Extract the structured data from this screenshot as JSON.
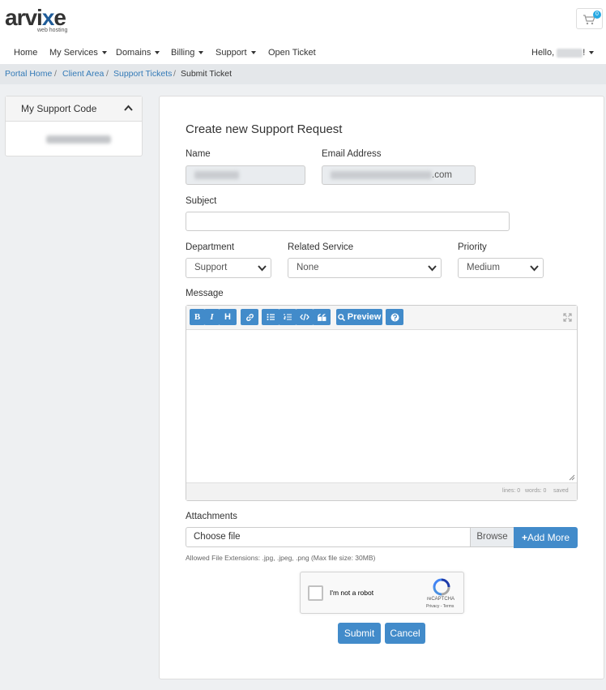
{
  "brand": {
    "logo_text_a": "arvi",
    "logo_text_x": "x",
    "logo_text_e": "e",
    "tagline": "web hosting",
    "accent": "#1f5c99"
  },
  "cart": {
    "count": "0",
    "icon": "cart-icon"
  },
  "nav": {
    "items": [
      {
        "label": "Home",
        "dropdown": false
      },
      {
        "label": "My Services",
        "dropdown": true
      },
      {
        "label": "Domains",
        "dropdown": true
      },
      {
        "label": "Billing",
        "dropdown": true
      },
      {
        "label": "Support",
        "dropdown": true
      },
      {
        "label": "Open Ticket",
        "dropdown": false
      }
    ],
    "greeting_prefix": "Hello,",
    "greeting_suffix": "!"
  },
  "breadcrumb": {
    "items": [
      "Portal Home",
      "Client Area",
      "Support Tickets",
      "Submit Ticket"
    ],
    "separator": "/"
  },
  "sidebar": {
    "title": "My Support Code"
  },
  "form": {
    "title": "Create new Support Request",
    "name_label": "Name",
    "email_label": "Email Address",
    "email_suffix": ".com",
    "subject_label": "Subject",
    "department_label": "Department",
    "department_value": "Support",
    "service_label": "Related Service",
    "service_value": "None",
    "priority_label": "Priority",
    "priority_value": "Medium",
    "message_label": "Message",
    "toolbar": {
      "bold": "B",
      "italic": "I",
      "heading": "H",
      "preview": "Preview"
    },
    "status": {
      "lines": "lines: 0",
      "words": "words: 0",
      "saved": "saved"
    },
    "attachments_label": "Attachments",
    "file_placeholder": "Choose file",
    "browse": "Browse",
    "add_more": "Add More",
    "allowed_hint": "Allowed File Extensions: .jpg, .jpeg, .png (Max file size: 30MB)",
    "submit": "Submit",
    "cancel": "Cancel"
  },
  "recaptcha": {
    "label": "I'm not a robot",
    "brand": "reCAPTCHA",
    "terms": "Privacy - Terms"
  },
  "colors": {
    "primary": "#428bca",
    "link": "#337ab7",
    "breadcrumb_bg": "#e4e7ea"
  }
}
